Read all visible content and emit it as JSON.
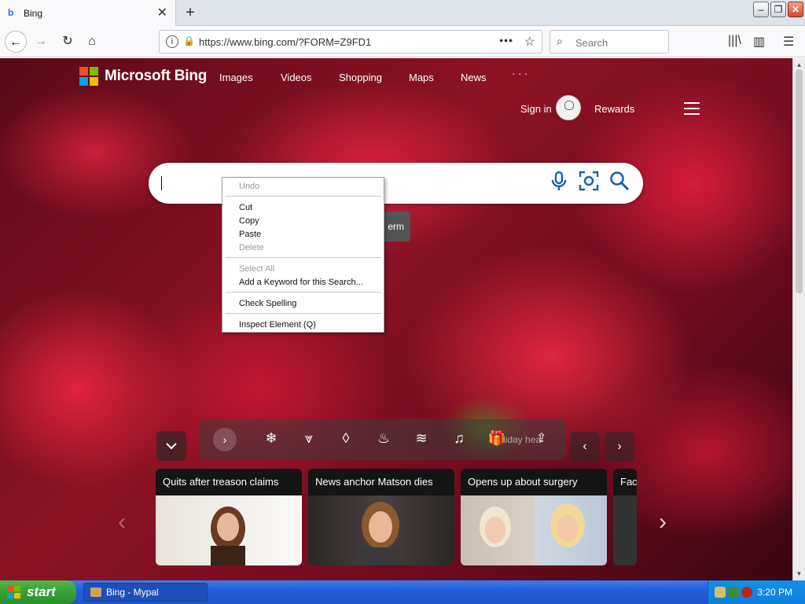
{
  "browser": {
    "tab_title": "Bing",
    "url": "https://www.bing.com/?FORM=Z9FD1",
    "search_placeholder": "Search",
    "page_actions": "•••"
  },
  "bing": {
    "brand": "Microsoft Bing",
    "nav": [
      "Images",
      "Videos",
      "Shopping",
      "Maps",
      "News",
      "· · ·"
    ],
    "sign_in": "Sign in",
    "rewards": "Rewards",
    "term_label": "erm",
    "holiday_label": "liday hea"
  },
  "context_menu": {
    "undo": "Undo",
    "cut": "Cut",
    "copy": "Copy",
    "paste": "Paste",
    "delete": "Delete",
    "select_all": "Select All",
    "add_keyword": "Add a Keyword for this Search...",
    "check_spelling": "Check Spelling",
    "inspect": "Inspect Element (Q)"
  },
  "news_cards": [
    {
      "headline": "Quits after treason claims"
    },
    {
      "headline": "News anchor Matson dies"
    },
    {
      "headline": "Opens up about surgery"
    },
    {
      "headline": "Fac"
    }
  ],
  "taskbar": {
    "start": "start",
    "window": "Bing - Mypal",
    "clock": "3:20 PM"
  },
  "colors": {
    "ms_red": "#f25022",
    "ms_green": "#7fba00",
    "ms_blue": "#00a4ef",
    "ms_yellow": "#ffb900",
    "bing_icon_blue": "#1a5fb4"
  }
}
